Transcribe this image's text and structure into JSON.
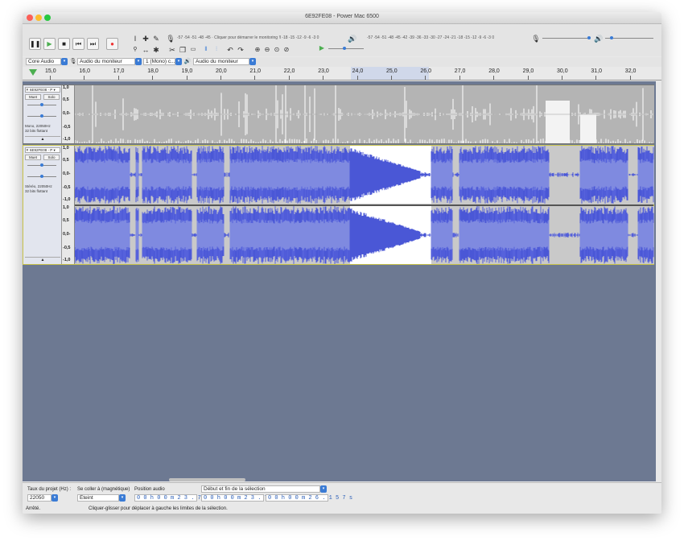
{
  "window": {
    "title": "6E92FE08 - Power Mac 6500"
  },
  "transport": {
    "pause_icon": "pause-icon",
    "play_icon": "play-icon",
    "stop_icon": "stop-icon",
    "skip_start_icon": "skip-start-icon",
    "skip_end_icon": "skip-end-icon",
    "record_icon": "record-icon",
    "pause": "❚❚",
    "play": "▶",
    "stop": "■",
    "skip_start": "⏮",
    "skip_end": "⏭",
    "record": "●"
  },
  "tools": {
    "select": "I",
    "envelope": "✚",
    "draw": "✎",
    "zoom": "🔍",
    "timeshift": "↔",
    "multi": "✱"
  },
  "edit": {
    "cut": "✂",
    "copy": "❐",
    "paste": "📋",
    "undo": "↶",
    "redo": "↷"
  },
  "meters": {
    "record_scale": "-57 -54 -51 -48 -45 · Cliquer pour démarrer le monitoring !l -18 -15 -12 -9 -6 -3 0",
    "play_scale": "-57 -54 -51 -48 -45 -42 -39 -36 -33 -30 -27 -24 -21 -18 -15 -12 -9 -6 -3 0",
    "lr": "G\nD"
  },
  "devices": {
    "host": "Core Audio",
    "recording_device": "Audio du moniteur",
    "channels": "1 (Mono) c...",
    "playback_device": "Audio du moniteur"
  },
  "timeline": {
    "ticks": [
      "15,0",
      "16,0",
      "17,0",
      "18,0",
      "19,0",
      "20,0",
      "21,0",
      "22,0",
      "23,0",
      "24,0",
      "25,0",
      "26,0",
      "27,0",
      "28,0",
      "29,0",
      "30,0",
      "31,0",
      "32,0"
    ]
  },
  "tracks": [
    {
      "name": "6E92FE08 - P",
      "mute": "Muet",
      "solo": "Solo",
      "info": [
        "Mono, 22050Hz",
        "32 bits flottant"
      ],
      "scale": [
        "1,0",
        "0,5",
        "0,0-",
        "-0,5",
        "-1,0"
      ]
    },
    {
      "name": "6E92FE08 - P",
      "mute": "Muet",
      "solo": "Solo",
      "info": [
        "Stéréo, 22050Hz",
        "32 bits flottant"
      ],
      "scale": [
        "1,0",
        "0,5",
        "0,0-",
        "-0,5",
        "-1,0"
      ],
      "scale2": [
        "1,0",
        "0,5",
        "0,0-",
        "-0,5",
        "-1,0"
      ]
    }
  ],
  "status": {
    "rate_label": "Taux du projet (Hz) :",
    "rate_value": "22050",
    "snap_label": "Se coller à (magnétique)",
    "snap_value": "Éteint",
    "position_label": "Position audio",
    "position_value": "0 0 h 0 0 m 2 3 . 7 7 7 s",
    "selection_mode": "Début et fin de la sélection",
    "sel_start": "0 0 h 0 0 m 2 3 . 7 7 7 s",
    "sel_end": "0 0 h 0 0 m 2 6 . 1 5 7 s",
    "state": "Arrêté.",
    "hint": "Cliquer-glisser pour déplacer à gauche les limites de la sélection."
  },
  "colors": {
    "wave_blue": "#4a57d6",
    "wave_light": "#7f8ae0",
    "background": "#6d7992",
    "selection": "#ffffff"
  }
}
